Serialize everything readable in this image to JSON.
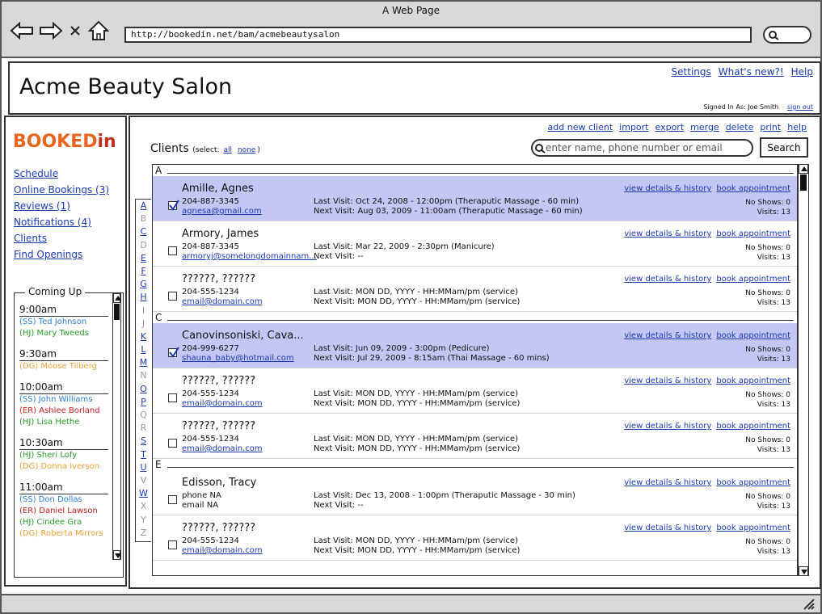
{
  "browser": {
    "title": "A Web Page",
    "url": "http://bookedin.net/bam/acmebeautysalon"
  },
  "header": {
    "app_title": "Acme Beauty Salon",
    "links": [
      "Settings",
      "What's new?!",
      "Help"
    ],
    "signed_in_label": "Signed In As: Joe Smith",
    "sign_out": "sign out"
  },
  "sidebar": {
    "logo_main": "BOOKED",
    "logo_accent": "in",
    "nav": [
      "Schedule",
      "Online Bookings (3)",
      "Reviews (1)",
      "Notifications (4)",
      "Clients",
      "Find Openings"
    ],
    "coming_up": {
      "title": "Coming Up",
      "slots": [
        {
          "time": "9:00am",
          "appointments": [
            {
              "text": "(SS) Ted Johnson",
              "color": "#2a7fcf"
            },
            {
              "text": "(HJ) Mary Tweeds",
              "color": "#2a9a2a"
            }
          ]
        },
        {
          "time": "9:30am",
          "appointments": [
            {
              "text": "(DG) Moose Tilberg",
              "color": "#e8a23a"
            }
          ]
        },
        {
          "time": "10:00am",
          "appointments": [
            {
              "text": "(SS) John Williams",
              "color": "#2a7fcf"
            },
            {
              "text": "(ER) Ashlee Borland",
              "color": "#c02020"
            },
            {
              "text": "(HJ) Lisa Hethe",
              "color": "#2a9a2a"
            }
          ]
        },
        {
          "time": "10:30am",
          "appointments": [
            {
              "text": "(HJ) Sheri Lofy",
              "color": "#2a9a2a"
            },
            {
              "text": "(DG) Donna Iverson",
              "color": "#e8a23a"
            }
          ]
        },
        {
          "time": "11:00am",
          "appointments": [
            {
              "text": "(SS) Don Dollas",
              "color": "#2a7fcf"
            },
            {
              "text": "(ER) Daniel Lawson",
              "color": "#c02020"
            },
            {
              "text": "(HJ) Cindee Gra",
              "color": "#2a9a2a"
            },
            {
              "text": "(DG) Roberta Mirrors",
              "color": "#e8a23a"
            }
          ]
        }
      ]
    }
  },
  "main": {
    "actions": [
      "add new client",
      "import",
      "export",
      "merge",
      "delete",
      "print",
      "help"
    ],
    "heading": "Clients",
    "select_prefix": "(select:",
    "select_all": "all",
    "select_none": "none",
    "select_suffix": ")",
    "search_placeholder": "enter name, phone number or email",
    "search_button": "Search",
    "alphabet": [
      {
        "l": "A",
        "on": true
      },
      {
        "l": "B",
        "on": false
      },
      {
        "l": "C",
        "on": true
      },
      {
        "l": "D",
        "on": false
      },
      {
        "l": "E",
        "on": true
      },
      {
        "l": "F",
        "on": true
      },
      {
        "l": "G",
        "on": true
      },
      {
        "l": "H",
        "on": true
      },
      {
        "l": "I",
        "on": false
      },
      {
        "l": "J",
        "on": false
      },
      {
        "l": "K",
        "on": true
      },
      {
        "l": "L",
        "on": true
      },
      {
        "l": "M",
        "on": true
      },
      {
        "l": "N",
        "on": false
      },
      {
        "l": "O",
        "on": true
      },
      {
        "l": "P",
        "on": true
      },
      {
        "l": "Q",
        "on": false
      },
      {
        "l": "R",
        "on": false
      },
      {
        "l": "S",
        "on": true
      },
      {
        "l": "T",
        "on": true
      },
      {
        "l": "U",
        "on": true
      },
      {
        "l": "V",
        "on": false
      },
      {
        "l": "W",
        "on": true
      },
      {
        "l": "X",
        "on": false
      },
      {
        "l": "Y",
        "on": false
      },
      {
        "l": "Z",
        "on": false
      }
    ],
    "row_links": {
      "details": "view details & history",
      "book": "book appointment"
    },
    "groups": [
      {
        "letter": "A",
        "clients": [
          {
            "name": "Amille, Agnes",
            "phone": "204-887-3345",
            "email": "agnesa@gmail.com",
            "email_link": true,
            "last": "Last Visit: Oct 24, 2008 - 12:00pm (Theraputic Massage - 60 min)",
            "next": "Next Visit: Aug 03, 2009 - 11:00am (Theraputic Massage - 60 min)",
            "no_shows": "No Shows: 0",
            "visits": "Visits: 13",
            "checked": true
          },
          {
            "name": "Armory, James",
            "phone": "204-887-3345",
            "email": "armoryj@somelongdomainnam...",
            "email_link": true,
            "last": "Last Visit: Mar 22, 2009 - 2:30pm (Manicure)",
            "next": "Next Visit: --",
            "no_shows": "No Shows: 0",
            "visits": "Visits: 13",
            "checked": false
          },
          {
            "name": "??????, ??????",
            "phone": "204-555-1234",
            "email": "email@domain.com",
            "email_link": true,
            "last": "Last Visit: MON DD, YYYY - HH:MMam/pm (service)",
            "next": "Next Visit: MON DD, YYYY - HH:MMam/pm (service)",
            "no_shows": "No Shows: 0",
            "visits": "Visits: 13",
            "checked": false
          }
        ]
      },
      {
        "letter": "C",
        "clients": [
          {
            "name": "Canovinsoniski, Cava...",
            "phone": "204-999-6277",
            "email": "shauna_baby@hotmail.com",
            "email_link": true,
            "last": "Last Visit: Jun 09, 2009 - 3:00pm (Pedicure)",
            "next": "Next Visit: Jul 29, 2009 - 8:15am (Thai Massage - 60 mins)",
            "no_shows": "No Shows: 0",
            "visits": "Visits: 13",
            "checked": true
          },
          {
            "name": "??????, ??????",
            "phone": "204-555-1234",
            "email": "email@domain.com",
            "email_link": true,
            "last": "Last Visit: MON DD, YYYY - HH:MMam/pm (service)",
            "next": "Next Visit: MON DD, YYYY - HH:MMam/pm (service)",
            "no_shows": "No Shows: 0",
            "visits": "Visits: 13",
            "checked": false
          },
          {
            "name": "??????, ??????",
            "phone": "204-555-1234",
            "email": "email@domain.com",
            "email_link": true,
            "last": "Last Visit: MON DD, YYYY - HH:MMam/pm (service)",
            "next": "Next Visit: MON DD, YYYY - HH:MMam/pm (service)",
            "no_shows": "No Shows: 0",
            "visits": "Visits: 13",
            "checked": false
          }
        ]
      },
      {
        "letter": "E",
        "clients": [
          {
            "name": "Edisson, Tracy",
            "phone": "phone NA",
            "email": "email NA",
            "email_link": false,
            "last": "Last Visit: Dec 13, 2008 - 1:00pm (Theraputic Massage - 30 min)",
            "next": "Next Visit: --",
            "no_shows": "No Shows: 0",
            "visits": "Visits: 13",
            "checked": false
          },
          {
            "name": "??????, ??????",
            "phone": "204-555-1234",
            "email": "email@domain.com",
            "email_link": true,
            "last": "Last Visit: MON DD, YYYY - HH:MMam/pm (service)",
            "next": "Next Visit: MON DD, YYYY - HH:MMam/pm (service)",
            "no_shows": "No Shows: 0",
            "visits": "Visits: 13",
            "checked": false
          }
        ]
      }
    ]
  }
}
